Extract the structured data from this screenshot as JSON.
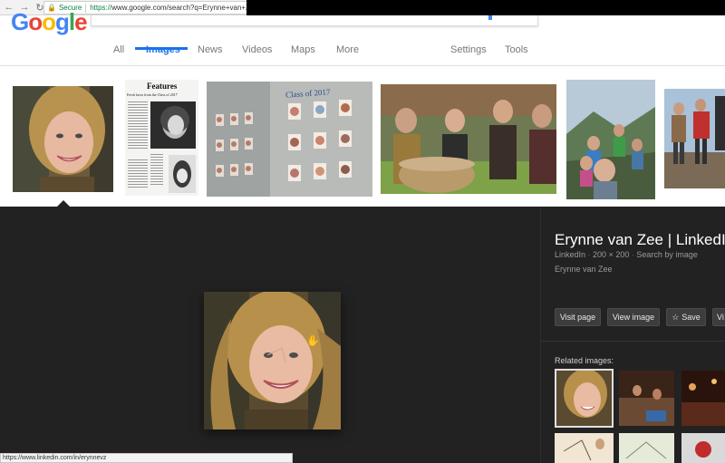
{
  "browser": {
    "secure_label": "Secure",
    "url_scheme": "https://",
    "url_rest": "www.google.com/search?q=Erynne+van+Zee+tufts"
  },
  "tabs": [
    {
      "label": "All"
    },
    {
      "label": "Images"
    },
    {
      "label": "News"
    },
    {
      "label": "Videos"
    },
    {
      "label": "Maps"
    },
    {
      "label": "More"
    },
    {
      "label": "Settings"
    },
    {
      "label": "Tools"
    }
  ],
  "strip": {
    "newspaper_heading": "Features",
    "newspaper_subheading": "Fresh faces from the Class of 2017",
    "yearbook_heading": "Class of 2017"
  },
  "detail": {
    "title": "Erynne van Zee | LinkedIn",
    "source": "LinkedIn",
    "dimensions": "200 × 200",
    "search_by_image": "Search by image",
    "caption": "Erynne van Zee",
    "buttons": {
      "visit_page": "Visit page",
      "view_image": "View image",
      "save": "Save",
      "more": "Vi"
    },
    "related_label": "Related images:"
  },
  "status_bar": "https://www.linkedin.com/in/erynnevz",
  "colors": {
    "accent": "#1a73e8",
    "dark_panel": "#222222",
    "secure_green": "#0b8043"
  }
}
